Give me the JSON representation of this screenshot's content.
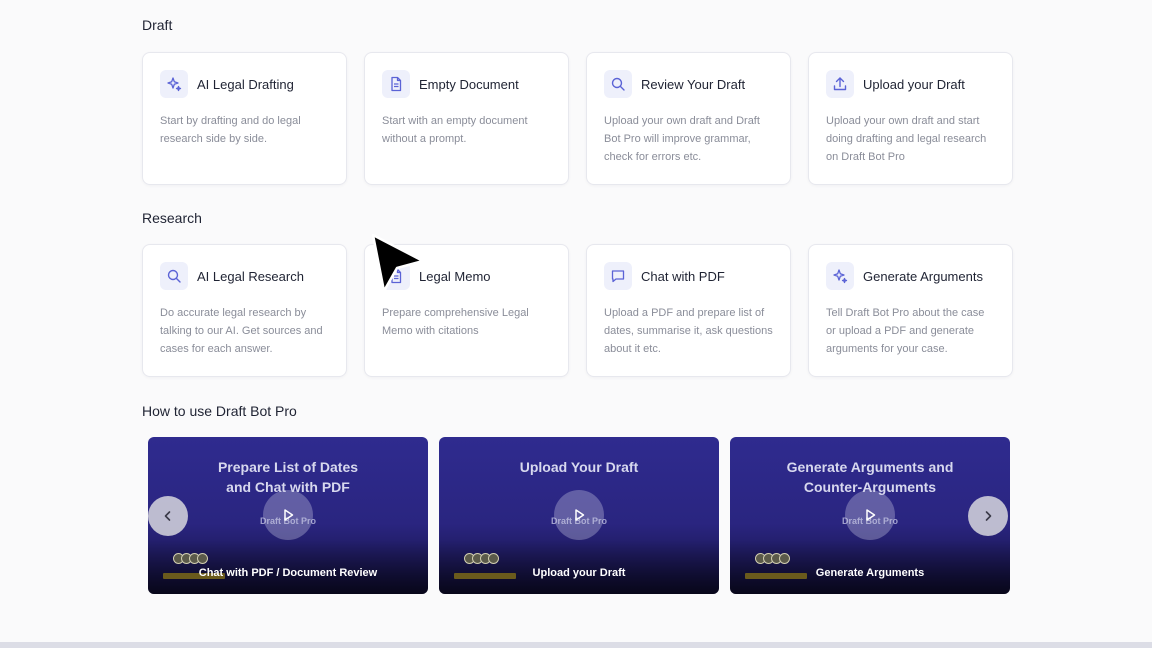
{
  "sections": {
    "draft": {
      "title": "Draft",
      "cards": [
        {
          "icon": "sparkles-icon",
          "title": "AI Legal Drafting",
          "desc": "Start by drafting and do legal research side by side."
        },
        {
          "icon": "document-icon",
          "title": "Empty Document",
          "desc": "Start with an empty document without a prompt."
        },
        {
          "icon": "search-icon",
          "title": "Review Your Draft",
          "desc": "Upload your own draft and Draft Bot Pro will improve grammar, check for errors etc."
        },
        {
          "icon": "upload-icon",
          "title": "Upload your Draft",
          "desc": "Upload your own draft and start doing drafting and legal research on Draft Bot Pro"
        }
      ]
    },
    "research": {
      "title": "Research",
      "cards": [
        {
          "icon": "search-icon",
          "title": "AI Legal Research",
          "desc": "Do accurate legal research by talking to our AI. Get sources and cases for each answer."
        },
        {
          "icon": "document-icon",
          "title": "Legal Memo",
          "desc": "Prepare comprehensive Legal Memo with citations"
        },
        {
          "icon": "chat-icon",
          "title": "Chat with PDF",
          "desc": "Upload a PDF and prepare list of dates, summarise it, ask questions about it etc."
        },
        {
          "icon": "sparkles-icon",
          "title": "Generate Arguments",
          "desc": "Tell Draft Bot Pro about the case or upload a PDF and generate arguments for your case."
        }
      ]
    },
    "howto": {
      "title": "How to use Draft Bot Pro",
      "videos": [
        {
          "title": "Prepare List of Dates\nand Chat with PDF",
          "logo": "Draft Bot Pro",
          "caption": "Chat with PDF / Document Review"
        },
        {
          "title": "Upload Your Draft",
          "logo": "Draft Bot Pro",
          "caption": "Upload your Draft"
        },
        {
          "title": "Generate Arguments and\nCounter-Arguments",
          "logo": "Draft Bot Pro",
          "caption": "Generate Arguments"
        }
      ]
    }
  },
  "icons": {
    "prev": "chevron-left-icon",
    "next": "chevron-right-icon",
    "play": "play-icon"
  },
  "colors": {
    "accent": "#5b63d6",
    "icon_bg": "#eef0fb",
    "video_bg": "#2a2580"
  }
}
